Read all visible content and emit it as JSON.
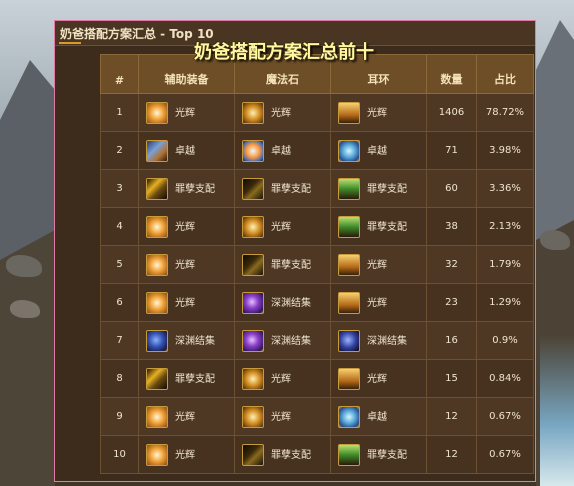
{
  "window_title": "奶爸搭配方案汇总 - Top 10",
  "overlay_title": "奶爸搭配方案汇总前十",
  "columns": [
    "#",
    "辅助装备",
    "魔法石",
    "耳环",
    "数量",
    "占比"
  ],
  "rows": [
    {
      "rank": "1",
      "sub": {
        "icon": "glory-icon",
        "label": "光辉"
      },
      "magic": {
        "icon": "glory-magic-stone-icon",
        "label": "光辉"
      },
      "ear": {
        "icon": "glory-earring-icon",
        "label": "光辉"
      },
      "count": "1406",
      "pct": "78.72%"
    },
    {
      "rank": "2",
      "sub": {
        "icon": "supreme-icon",
        "label": "卓越"
      },
      "magic": {
        "icon": "supreme-magic-stone-icon",
        "label": "卓越"
      },
      "ear": {
        "icon": "supreme-earring-icon",
        "label": "卓越"
      },
      "count": "71",
      "pct": "3.98%"
    },
    {
      "rank": "3",
      "sub": {
        "icon": "sin-icon",
        "label": "罪孽支配"
      },
      "magic": {
        "icon": "sin-magic-stone-icon",
        "label": "罪孽支配"
      },
      "ear": {
        "icon": "sin-earring-icon",
        "label": "罪孽支配"
      },
      "count": "60",
      "pct": "3.36%"
    },
    {
      "rank": "4",
      "sub": {
        "icon": "glory-icon",
        "label": "光辉"
      },
      "magic": {
        "icon": "glory-magic-stone-icon",
        "label": "光辉"
      },
      "ear": {
        "icon": "sin-earring-icon",
        "label": "罪孽支配"
      },
      "count": "38",
      "pct": "2.13%"
    },
    {
      "rank": "5",
      "sub": {
        "icon": "glory-icon",
        "label": "光辉"
      },
      "magic": {
        "icon": "sin-magic-stone-icon",
        "label": "罪孽支配"
      },
      "ear": {
        "icon": "glory-earring-icon",
        "label": "光辉"
      },
      "count": "32",
      "pct": "1.79%"
    },
    {
      "rank": "6",
      "sub": {
        "icon": "glory-icon",
        "label": "光辉"
      },
      "magic": {
        "icon": "abyss-magic-stone-icon",
        "label": "深渊结集"
      },
      "ear": {
        "icon": "glory-earring-icon",
        "label": "光辉"
      },
      "count": "23",
      "pct": "1.29%"
    },
    {
      "rank": "7",
      "sub": {
        "icon": "abyss-icon",
        "label": "深渊结集"
      },
      "magic": {
        "icon": "abyss-magic-stone-icon",
        "label": "深渊结集"
      },
      "ear": {
        "icon": "abyss-earring-icon",
        "label": "深渊结集"
      },
      "count": "16",
      "pct": "0.9%"
    },
    {
      "rank": "8",
      "sub": {
        "icon": "sin-icon",
        "label": "罪孽支配"
      },
      "magic": {
        "icon": "glory-magic-stone-icon",
        "label": "光辉"
      },
      "ear": {
        "icon": "glory-earring-icon",
        "label": "光辉"
      },
      "count": "15",
      "pct": "0.84%"
    },
    {
      "rank": "9",
      "sub": {
        "icon": "glory-icon",
        "label": "光辉"
      },
      "magic": {
        "icon": "glory-magic-stone-icon",
        "label": "光辉"
      },
      "ear": {
        "icon": "supreme-earring-icon",
        "label": "卓越"
      },
      "count": "12",
      "pct": "0.67%"
    },
    {
      "rank": "10",
      "sub": {
        "icon": "glory-icon",
        "label": "光辉"
      },
      "magic": {
        "icon": "sin-magic-stone-icon",
        "label": "罪孽支配"
      },
      "ear": {
        "icon": "sin-earring-icon",
        "label": "罪孽支配"
      },
      "count": "12",
      "pct": "0.67%"
    }
  ],
  "colors": {
    "panel_border": "#e07aa6",
    "header_bg": "#6d4e26",
    "overlay_title": "#fff8a0"
  }
}
